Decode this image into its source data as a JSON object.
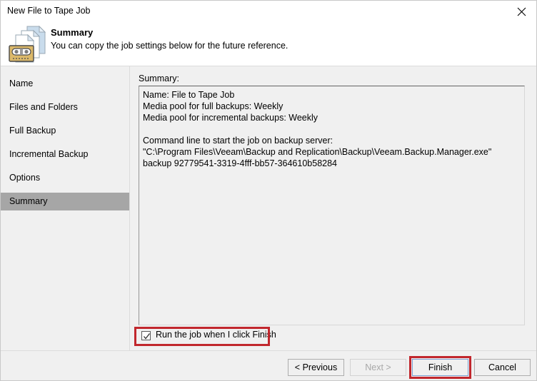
{
  "window": {
    "title": "New File to Tape Job",
    "close_icon": "close-icon"
  },
  "header": {
    "icon": "file-to-tape-icon",
    "title": "Summary",
    "subtitle": "You can copy the job settings below for the future reference."
  },
  "sidebar": {
    "items": [
      {
        "label": "Name",
        "selected": false
      },
      {
        "label": "Files and Folders",
        "selected": false
      },
      {
        "label": "Full Backup",
        "selected": false
      },
      {
        "label": "Incremental Backup",
        "selected": false
      },
      {
        "label": "Options",
        "selected": false
      },
      {
        "label": "Summary",
        "selected": true
      }
    ]
  },
  "main": {
    "summary_label": "Summary:",
    "summary_text": "Name: File to Tape Job\nMedia pool for full backups: Weekly\nMedia pool for incremental backups: Weekly\n\nCommand line to start the job on backup server:\n\"C:\\Program Files\\Veeam\\Backup and Replication\\Backup\\Veeam.Backup.Manager.exe\" backup 92779541-3319-4fff-bb57-364610b58284",
    "run_job_checkbox": {
      "label": "Run the job when I click Finish",
      "checked": true
    }
  },
  "footer": {
    "previous_label": "< Previous",
    "next_label": "Next >",
    "finish_label": "Finish",
    "cancel_label": "Cancel"
  },
  "annotations": {
    "color": "#c1272d",
    "highlighted": [
      "run-job-checkbox",
      "finish-button"
    ]
  },
  "colors": {
    "window_background": "#f0f0f0",
    "header_background": "#ffffff",
    "selected_nav": "#a6a6a6",
    "annotation_red": "#c1272d",
    "default_button_border": "#7a9fd1"
  }
}
